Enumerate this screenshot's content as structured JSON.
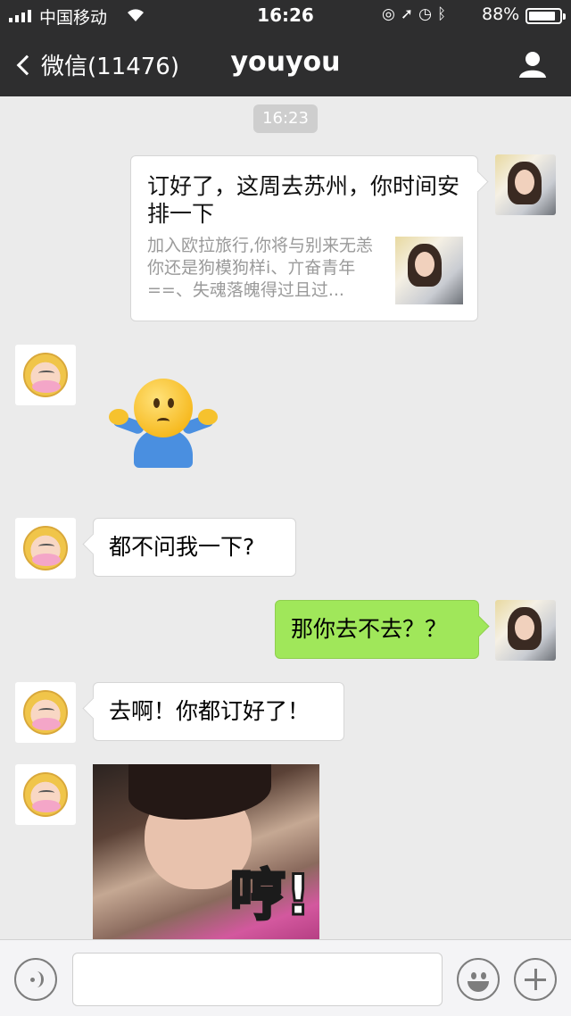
{
  "status_bar": {
    "carrier": "中国移动",
    "time": "16:26",
    "battery_percent": "88%",
    "battery_level": 0.88
  },
  "nav": {
    "back_label": "微信(11476)",
    "title": "youyou"
  },
  "chat": {
    "timestamp": "16:23",
    "link_card": {
      "title": "订好了，这周去苏州，你时间安排一下",
      "description": "加入欧拉旅行,你将与别来无恙你还是狗模狗样i、亣奋青年==、失魂落魄得过且过..."
    },
    "messages": {
      "friend_1": "都不问我一下?",
      "self_1": "那你去不去？？",
      "friend_2": "去啊！你都订好了！"
    },
    "meme_text": "哼!"
  },
  "icons": {
    "back": "chevron-left-icon",
    "contact": "person-icon",
    "voice": "voice-icon",
    "emoji": "emoji-icon",
    "add": "plus-icon"
  },
  "colors": {
    "nav_bg": "#2e2e2f",
    "chat_bg": "#ebebeb",
    "self_bubble": "#a0e75a",
    "friend_bubble": "#ffffff"
  }
}
